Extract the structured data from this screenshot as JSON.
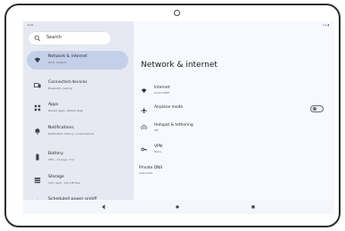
{
  "status_bar": {
    "time": "9:41",
    "icons": "▾ ▴ ▮"
  },
  "search": {
    "placeholder": "Search"
  },
  "sidebar": {
    "items": [
      {
        "title": "Network & internet",
        "subtitle": "Wi-Fi, hotspot",
        "icon": "wifi-icon",
        "selected": true
      },
      {
        "title": "Connected devices",
        "subtitle": "Bluetooth, pairing",
        "icon": "devices-icon"
      },
      {
        "title": "Apps",
        "subtitle": "Recent apps, default apps",
        "icon": "apps-icon"
      },
      {
        "title": "Notifications",
        "subtitle": "Notification history, conversations",
        "icon": "bell-icon"
      },
      {
        "title": "Battery",
        "subtitle": "58% · 14 days, 7 hr",
        "icon": "battery-icon"
      },
      {
        "title": "Storage",
        "subtitle": "14% used · 110 GB free",
        "icon": "storage-icon"
      },
      {
        "title": "Scheduled power on/off",
        "subtitle": "",
        "icon": "power-icon"
      }
    ]
  },
  "main": {
    "title": "Network & internet",
    "settings": [
      {
        "title": "Internet",
        "subtitle": "AndroidWifi",
        "icon": "wifi-icon"
      },
      {
        "title": "Airplane mode",
        "subtitle": "",
        "icon": "airplane-icon",
        "toggle": false
      },
      {
        "title": "Hotspot & tethering",
        "subtitle": "Off",
        "icon": "hotspot-icon"
      },
      {
        "title": "VPN",
        "subtitle": "None",
        "icon": "vpn-icon"
      },
      {
        "title": "Private DNS",
        "subtitle": "Automatic",
        "icon": ""
      }
    ]
  },
  "colors": {
    "left_pane": "#e6e9f1",
    "right_pane": "#f7f9fe",
    "selected_item": "#c4d0ea"
  }
}
